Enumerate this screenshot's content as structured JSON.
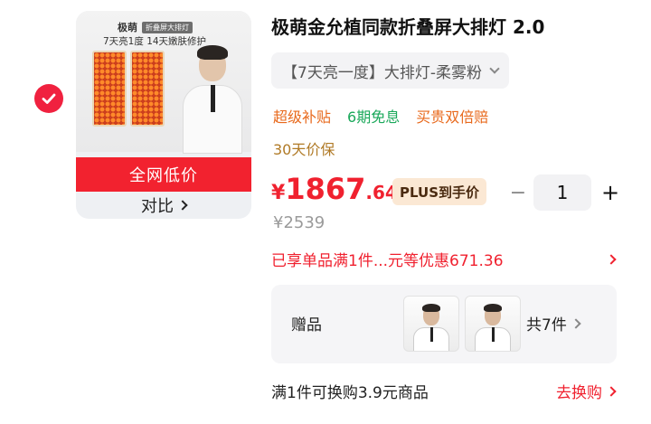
{
  "product": {
    "title": "极萌金允植同款折叠屏大排灯 2.0",
    "variant": "【7天亮一度】大排灯-柔雾粉"
  },
  "thumbnail": {
    "brand": "极萌",
    "brand_tag": "折叠屏大排灯",
    "subtitle": "7天亮1度  14天嫩肤修护",
    "lowest_price_label": "全网低价",
    "compare_label": "对比"
  },
  "promos": {
    "subsidy": "超级补贴",
    "installment": "6期免息",
    "double_refund": "买贵双倍赔",
    "price_protect": "30天价保"
  },
  "price": {
    "currency": "¥",
    "integer": "1867",
    "decimal": ".64",
    "plus_label": "PLUS到手价",
    "original": "¥2539"
  },
  "quantity": {
    "minus": "−",
    "value": "1",
    "plus": "+"
  },
  "discount": {
    "text": "已享单品满1件...元等优惠671.36"
  },
  "gift": {
    "label": "赠品",
    "count": "共7件"
  },
  "exchange": {
    "text": "满1件可换购3.9元商品",
    "link": "去换购"
  },
  "colors": {
    "accent_red": "#f0212f",
    "promo_orange": "#e8691c",
    "promo_green": "#1aa85a",
    "guarantee_brown": "#b07a26",
    "plus_bg": "#fbe8d4"
  },
  "icons": {
    "check": "checkmark-icon",
    "chevron": "chevron-right-icon",
    "dropdown": "chevron-down-icon"
  }
}
